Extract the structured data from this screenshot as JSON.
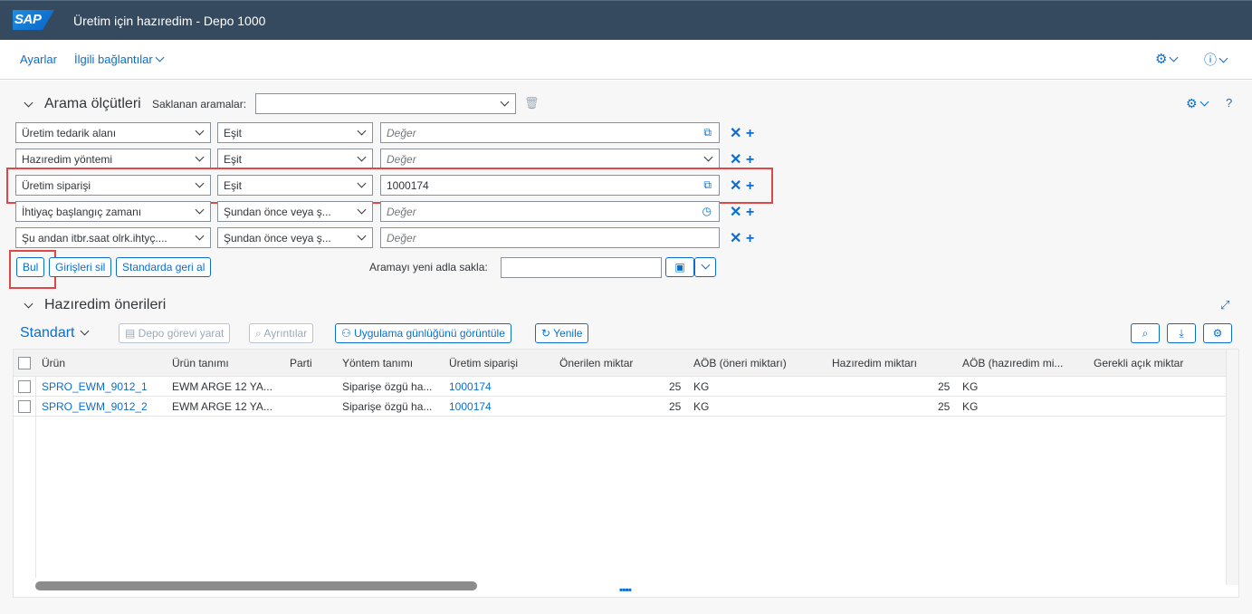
{
  "shell": {
    "logo": "SAP",
    "title": "Üretim için hazıredim - Depo 1000"
  },
  "menu": {
    "settings": "Ayarlar",
    "related": "İlgili bağlantılar"
  },
  "search": {
    "header": "Arama ölçütleri",
    "saved_label": "Saklanan aramalar:",
    "saved_value": "",
    "rows": [
      {
        "field": "Üretim tedarik alanı",
        "op": "Eşit",
        "value": "",
        "placeholder": "Değer"
      },
      {
        "field": "Hazıredim yöntemi",
        "op": "Eşit",
        "value": "",
        "placeholder": "Değer"
      },
      {
        "field": "Üretim siparişi",
        "op": "Eşit",
        "value": "1000174",
        "placeholder": ""
      },
      {
        "field": "İhtiyaç başlangıç zamanı",
        "op": "Şundan önce veya ş...",
        "value": "",
        "placeholder": "Değer"
      },
      {
        "field": "Şu andan itbr.saat olrk.ihtyç....",
        "op": "Şundan önce veya ş...",
        "value": "",
        "placeholder": "Değer"
      }
    ],
    "buttons": {
      "find": "Bul",
      "clear": "Girişleri sil",
      "reset": "Standarda geri al"
    },
    "save_label": "Aramayı yeni adla sakla:",
    "save_value": ""
  },
  "proposals": {
    "header": "Hazıredim önerileri",
    "variant": "Standart",
    "toolbar": {
      "create_task": "Depo görevi yarat",
      "details": "Ayrıntılar",
      "app_log": "Uygulama günlüğünü görüntüle",
      "refresh": "Yenile"
    },
    "columns": [
      "Ürün",
      "Ürün tanımı",
      "Parti",
      "Yöntem tanımı",
      "Üretim siparişi",
      "Önerilen miktar",
      "AÖB (öneri miktarı)",
      "Hazıredim miktarı",
      "AÖB (hazıredim mi...",
      "Gerekli açık miktar"
    ],
    "rows": [
      {
        "product": "SPRO_EWM_9012_1",
        "desc": "EWM ARGE 12 YA...",
        "batch": "",
        "method": "Siparişe özgü ha...",
        "order": "1000174",
        "qty": "25",
        "uom": "KG",
        "sqty": "25",
        "suom": "KG",
        "open": ""
      },
      {
        "product": "SPRO_EWM_9012_2",
        "desc": "EWM ARGE 12 YA...",
        "batch": "",
        "method": "Siparişe özgü ha...",
        "order": "1000174",
        "qty": "25",
        "uom": "KG",
        "sqty": "25",
        "suom": "KG",
        "open": ""
      }
    ]
  },
  "colors": {
    "shell": "#354a5f",
    "accent": "#0a6ed1",
    "highlight": "#e04848"
  }
}
